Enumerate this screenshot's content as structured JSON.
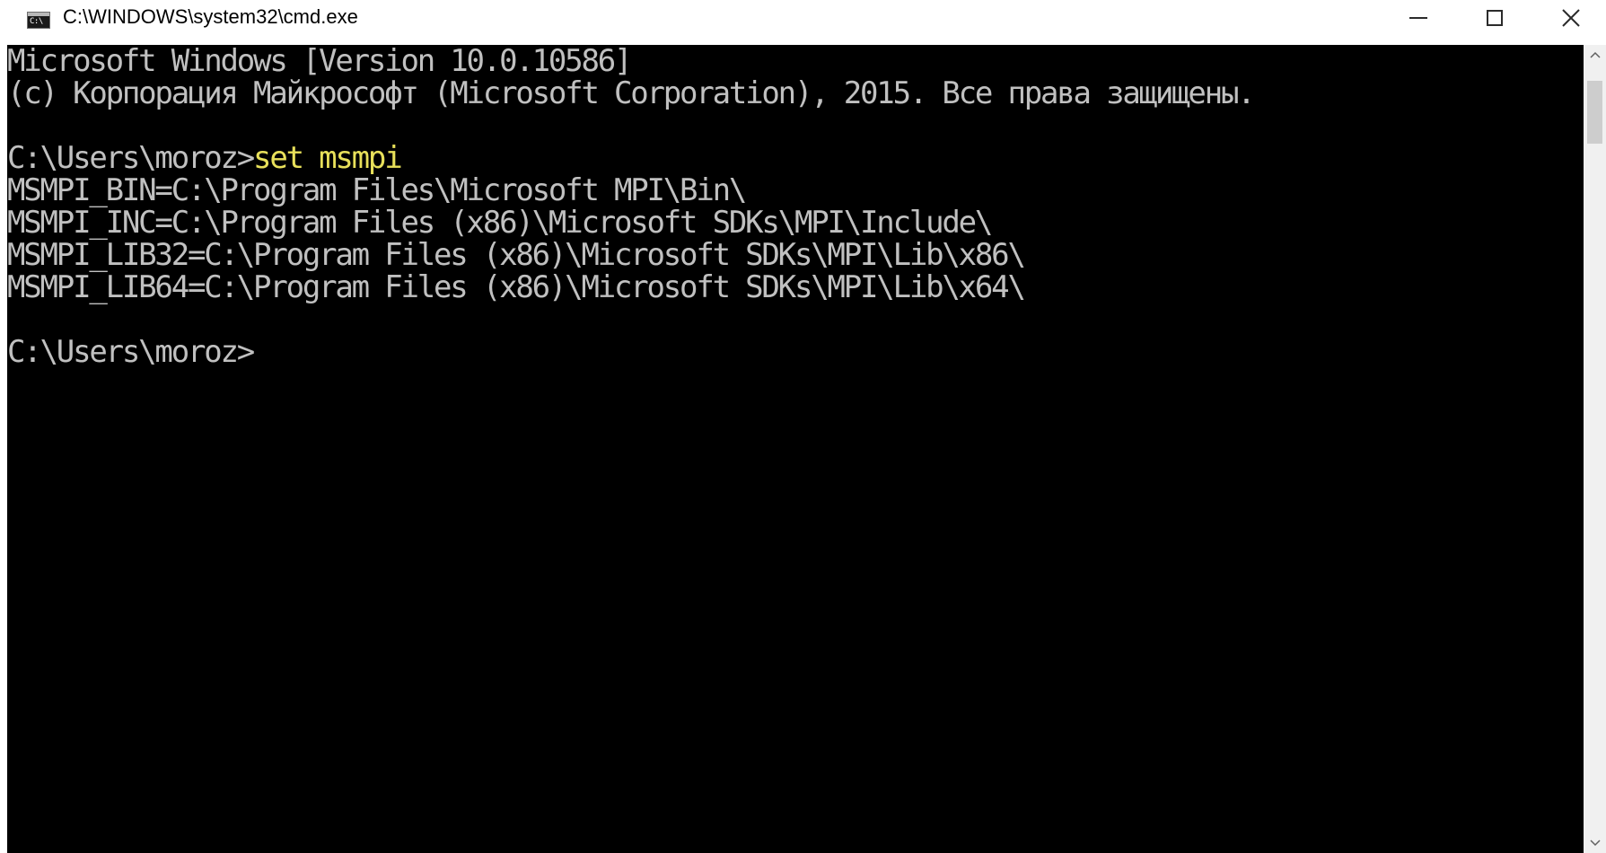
{
  "window": {
    "title": "C:\\WINDOWS\\system32\\cmd.exe",
    "icon": "cmd-icon",
    "icon_text": "C:\\",
    "controls": [
      "minimize-icon",
      "maximize-icon",
      "close-icon"
    ]
  },
  "console": {
    "background": "#000000",
    "text_color": "#c0c0c0",
    "command_color": "#e8e05a",
    "lines": {
      "banner_version": "Microsoft Windows [Version 10.0.10586]",
      "banner_copyright": "(c) Корпорация Майкрософт (Microsoft Corporation), 2015. Все права защищены.",
      "prompt_1": "C:\\Users\\moroz>",
      "command_1": "set msmpi",
      "output_bin": "MSMPI_BIN=C:\\Program Files\\Microsoft MPI\\Bin\\",
      "output_inc": "MSMPI_INC=C:\\Program Files (x86)\\Microsoft SDKs\\MPI\\Include\\",
      "output_lib32": "MSMPI_LIB32=C:\\Program Files (x86)\\Microsoft SDKs\\MPI\\Lib\\x86\\",
      "output_lib64": "MSMPI_LIB64=C:\\Program Files (x86)\\Microsoft SDKs\\MPI\\Lib\\x64\\",
      "prompt_2": "C:\\Users\\moroz>"
    }
  },
  "scrollbar": {
    "up_icon": "chevron-up-icon",
    "down_icon": "chevron-down-icon"
  }
}
